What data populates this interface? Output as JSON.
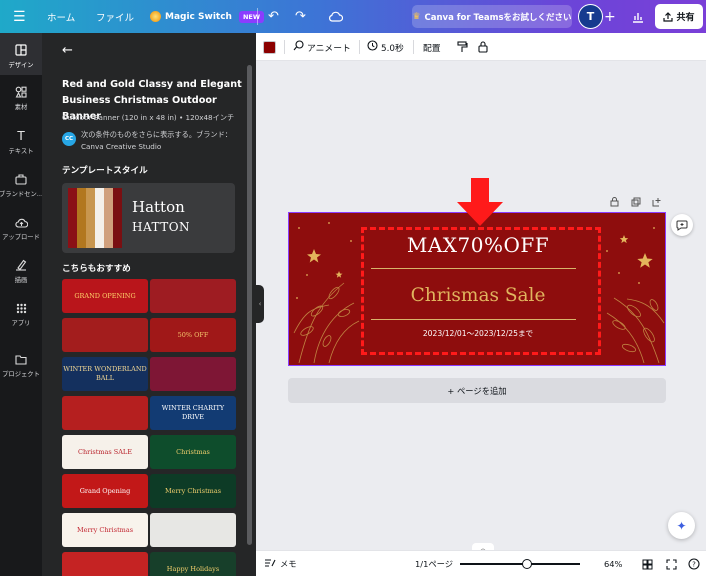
{
  "topbar": {
    "menu_icon": "hamburger-icon",
    "home": "ホーム",
    "file": "ファイル",
    "magic_switch": "Magic Switch",
    "new_badge": "NEW",
    "teams": "Canva for Teamsをお試しください",
    "avatar_initial": "T",
    "share": "共有"
  },
  "rail": {
    "items": [
      {
        "label": "デザイン",
        "icon": "layout-icon"
      },
      {
        "label": "素材",
        "icon": "elements-icon"
      },
      {
        "label": "テキスト",
        "icon": "text-icon"
      },
      {
        "label": "ブランドセン…",
        "icon": "brand-icon"
      },
      {
        "label": "アップロード",
        "icon": "upload-icon"
      },
      {
        "label": "描画",
        "icon": "draw-icon"
      },
      {
        "label": "アプリ",
        "icon": "apps-icon"
      },
      {
        "label": "プロジェクト",
        "icon": "folder-icon"
      }
    ]
  },
  "panel": {
    "title": "Red and Gold Classy and Elegant Business Christmas Outdoor Banner",
    "dims": "Outdoor Banner (120 in x 48 in) • 120x48インチ",
    "brand_badge": "CC",
    "brand": "次の条件のものをさらに表示する。ブランド：Canva Creative Studio",
    "style_heading": "テンプレートスタイル",
    "style_font_1": "Hatton",
    "style_font_2": "HATTON",
    "rec_heading": "こちらもおすすめ",
    "thumbs": [
      {
        "text": "GRAND OPENING",
        "bg": "#b9151b",
        "fg": "#ffd36a"
      },
      {
        "text": "",
        "bg": "#9e1c22",
        "fg": "#f2d48a"
      },
      {
        "text": "",
        "bg": "#a31d1d",
        "fg": "#f5d28c"
      },
      {
        "text": "50% OFF",
        "bg": "#a01818",
        "fg": "#f3c56b"
      },
      {
        "text": "WINTER WONDERLAND BALL",
        "bg": "#14305e",
        "fg": "#f4d996"
      },
      {
        "text": "",
        "bg": "#7e1635",
        "fg": "#f1c8a0"
      },
      {
        "text": "",
        "bg": "#b51f1f",
        "fg": "#ffffff"
      },
      {
        "text": "WINTER CHARITY DRIVE",
        "bg": "#123b73",
        "fg": "#ffffff"
      },
      {
        "text": "Christmas SALE",
        "bg": "#f6f1ea",
        "fg": "#b8222b"
      },
      {
        "text": "Christmas",
        "bg": "#0e4d2c",
        "fg": "#f1cf6d"
      },
      {
        "text": "Grand Opening",
        "bg": "#c21818",
        "fg": "#ffffff"
      },
      {
        "text": "Merry Christmas",
        "bg": "#0d3b26",
        "fg": "#f1cf6d"
      },
      {
        "text": "Merry Christmas",
        "bg": "#f8f3ec",
        "fg": "#c2232e"
      },
      {
        "text": "",
        "bg": "#e7e7e4",
        "fg": "#2d2d2d"
      },
      {
        "text": "",
        "bg": "#c52323",
        "fg": "#ffffff"
      },
      {
        "text": "Happy Holidays",
        "bg": "#173f2a",
        "fg": "#f1cf6d"
      }
    ]
  },
  "toolbar": {
    "animate": "アニメート",
    "duration": "5.0秒",
    "position": "配置"
  },
  "banner": {
    "title": "MAX70%OFF",
    "sale": "Chrismas Sale",
    "date": "2023/12/01〜2023/12/25まで"
  },
  "canvas": {
    "add_page": "+ ページを追加"
  },
  "bottombar": {
    "notes": "メモ",
    "page": "1/1ページ",
    "zoom": "64%"
  }
}
